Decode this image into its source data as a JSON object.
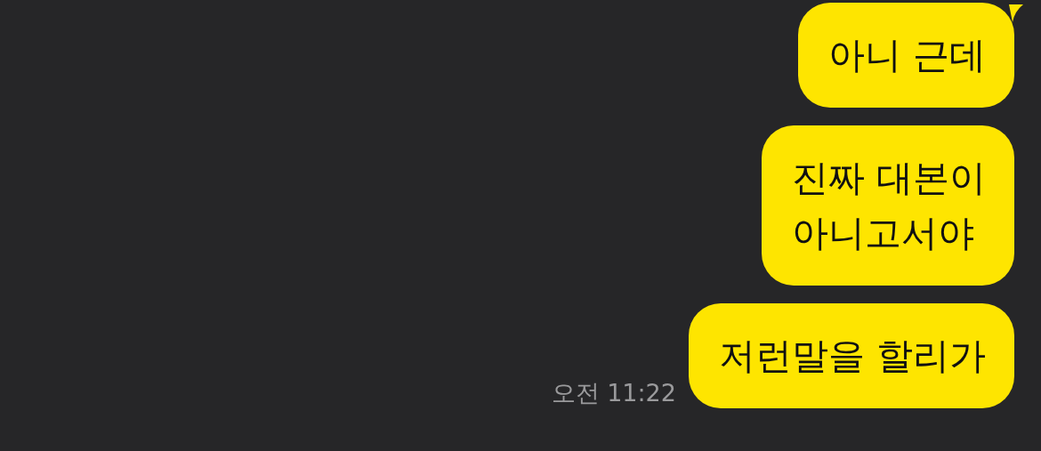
{
  "messages": [
    {
      "lines": [
        "아니 근데"
      ],
      "tail": true
    },
    {
      "lines": [
        "진짜 대본이",
        "아니고서야"
      ],
      "tail": false
    },
    {
      "lines": [
        "저런말을 할리가"
      ],
      "tail": false,
      "time": "오전 11:22"
    }
  ]
}
